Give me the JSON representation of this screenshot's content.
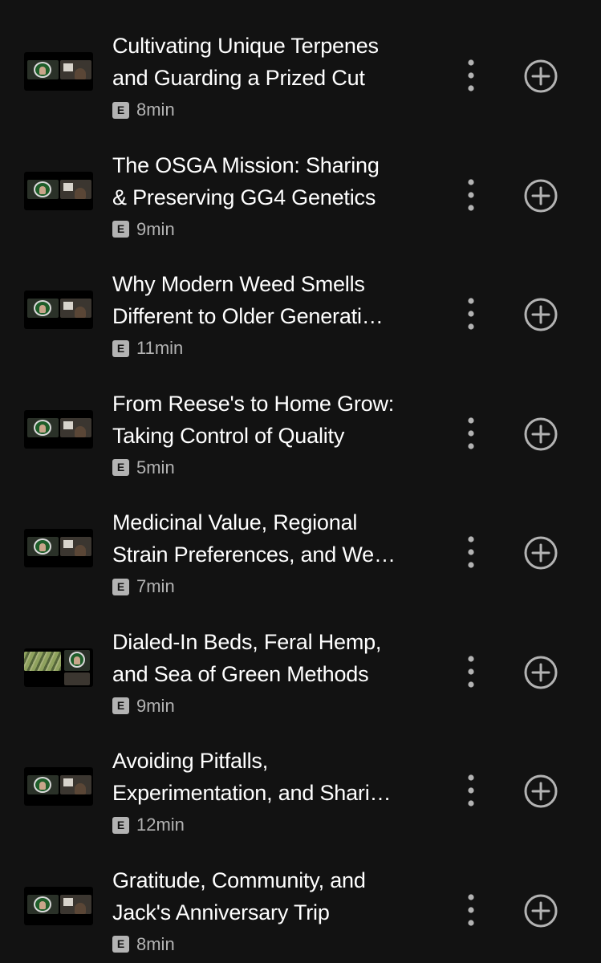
{
  "episodes": [
    {
      "title_lines": [
        "Cultivating Unique Terpenes",
        "and Guarding a Prized Cut"
      ],
      "badge": "E",
      "duration": "8min",
      "thumbnail": "video-call-thumbnail"
    },
    {
      "title_lines": [
        "The OSGA Mission: Sharing",
        "& Preserving GG4 Genetics"
      ],
      "badge": "E",
      "duration": "9min",
      "thumbnail": "video-call-thumbnail"
    },
    {
      "title_lines": [
        "Why Modern Weed Smells",
        "Different to Older Generati…"
      ],
      "badge": "E",
      "duration": "11min",
      "thumbnail": "video-call-thumbnail"
    },
    {
      "title_lines": [
        "From Reese's to Home Grow:",
        "Taking Control of Quality"
      ],
      "badge": "E",
      "duration": "5min",
      "thumbnail": "video-call-thumbnail"
    },
    {
      "title_lines": [
        "Medicinal Value, Regional",
        "Strain Preferences, and We…"
      ],
      "badge": "E",
      "duration": "7min",
      "thumbnail": "video-call-thumbnail"
    },
    {
      "title_lines": [
        "Dialed-In Beds, Feral Hemp,",
        "and Sea of Green Methods"
      ],
      "badge": "E",
      "duration": "9min",
      "thumbnail": "garden-video-call-thumbnail"
    },
    {
      "title_lines": [
        "Avoiding Pitfalls,",
        "Experimentation, and Shari…"
      ],
      "badge": "E",
      "duration": "12min",
      "thumbnail": "video-call-thumbnail"
    },
    {
      "title_lines": [
        "Gratitude, Community, and",
        "Jack's Anniversary Trip"
      ],
      "badge": "E",
      "duration": "8min",
      "thumbnail": "video-call-thumbnail"
    }
  ],
  "icons": {
    "more": "more-vertical-icon",
    "add": "add-circle-icon"
  },
  "colors": {
    "background": "#121212",
    "title_text": "#ffffff",
    "secondary_text": "#b3b3b3",
    "icon": "#b3b3b3"
  }
}
